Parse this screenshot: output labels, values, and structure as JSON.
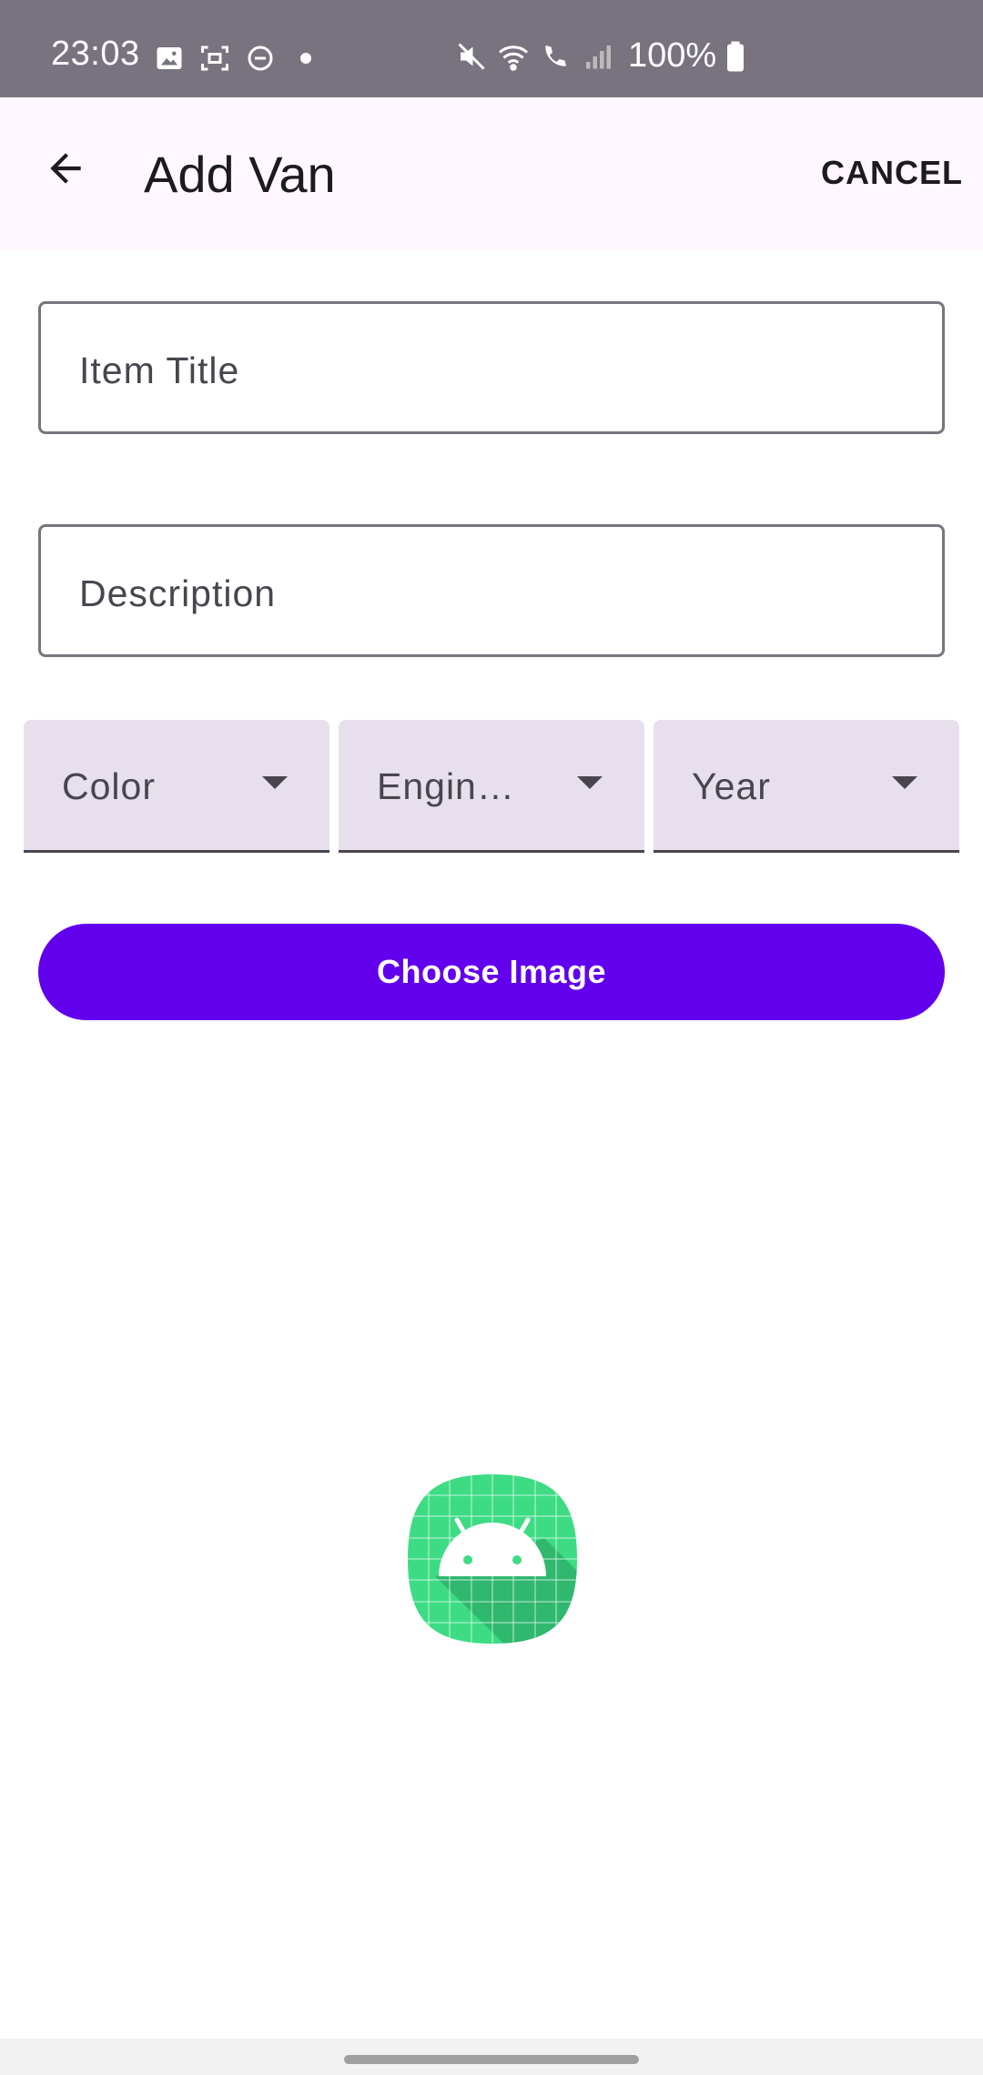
{
  "status_bar": {
    "time": "23:03",
    "left_icons": [
      "image-icon",
      "screenshot-icon",
      "do-not-disturb-icon",
      "dot-icon"
    ],
    "right_icons": [
      "mute-icon",
      "wifi-icon",
      "wifi-calling-icon",
      "signal-icon",
      "battery-icon"
    ],
    "battery": "100%"
  },
  "app_bar": {
    "back_icon": "arrow-back-icon",
    "title": "Add Van",
    "cancel_label": "CANCEL"
  },
  "form": {
    "title_field": {
      "placeholder": "Item Title",
      "value": ""
    },
    "description_field": {
      "placeholder": "Description",
      "value": ""
    },
    "dropdowns": [
      {
        "label": "Color"
      },
      {
        "label": "Engin…"
      },
      {
        "label": "Year"
      }
    ],
    "choose_image_label": "Choose Image"
  },
  "preview": {
    "icon": "android-placeholder-icon"
  },
  "colors": {
    "primary": "#6200ee",
    "status_bar": "#78737e",
    "app_bar_bg": "#fef7ff",
    "dropdown_bg": "#e7e0ec",
    "outline": "#79747e"
  }
}
